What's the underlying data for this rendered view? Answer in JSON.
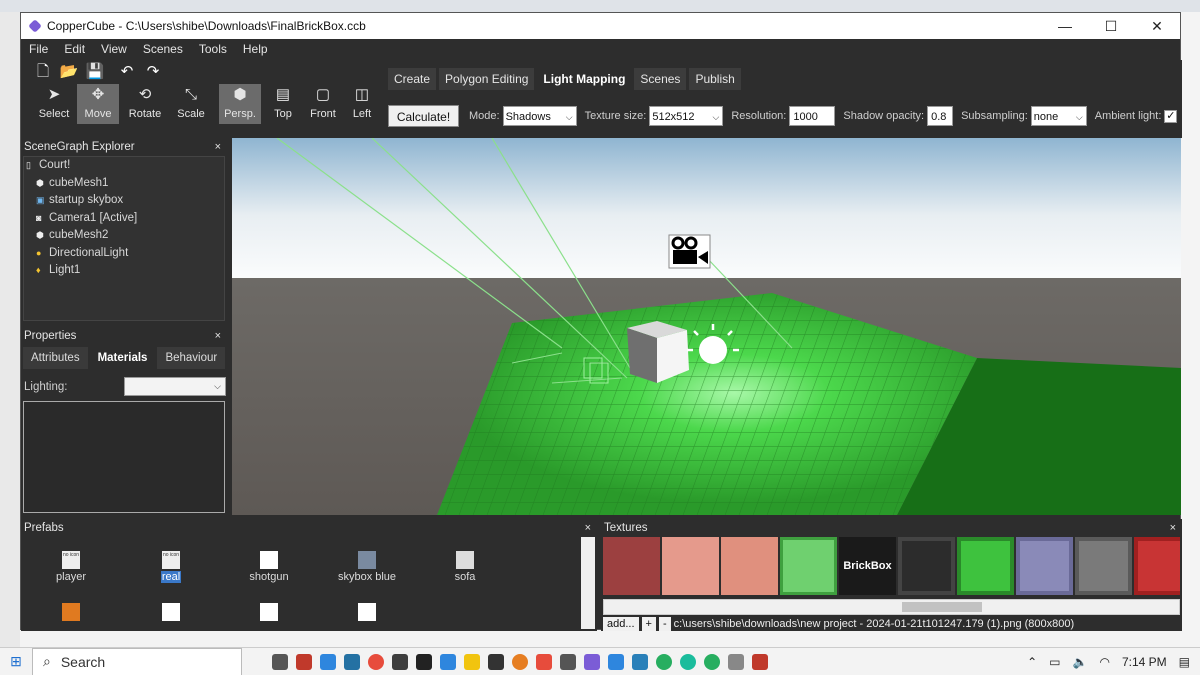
{
  "window": {
    "title": "CopperCube - C:\\Users\\shibe\\Downloads\\FinalBrickBox.ccb",
    "minimize": "—",
    "maximize": "☐",
    "close": "✕"
  },
  "menu": [
    "File",
    "Edit",
    "View",
    "Scenes",
    "Tools",
    "Help"
  ],
  "tools": [
    {
      "label": "Select",
      "icon": "cursor-icon"
    },
    {
      "label": "Move",
      "icon": "move-icon"
    },
    {
      "label": "Rotate",
      "icon": "rotate-icon"
    },
    {
      "label": "Scale",
      "icon": "scale-icon"
    },
    {
      "label": "Persp.",
      "icon": "cube-icon"
    },
    {
      "label": "Top",
      "icon": "top-view-icon"
    },
    {
      "label": "Front",
      "icon": "front-view-icon"
    },
    {
      "label": "Left",
      "icon": "left-view-icon"
    }
  ],
  "mode_tabs": [
    "Create",
    "Polygon Editing",
    "Light Mapping",
    "Scenes",
    "Publish"
  ],
  "light_mapping": {
    "calculate": "Calculate!",
    "mode_label": "Mode:",
    "mode_value": "Shadows",
    "texture_label": "Texture size:",
    "texture_value": "512x512",
    "resolution_label": "Resolution:",
    "resolution_value": "1000",
    "opacity_label": "Shadow opacity:",
    "opacity_value": "0.8",
    "subsampling_label": "Subsampling:",
    "subsampling_value": "none",
    "ambient_label": "Ambient light:",
    "ambient_checked": "✓"
  },
  "scenegraph": {
    "title": "SceneGraph Explorer",
    "close": "×",
    "items": [
      {
        "label": "Court!",
        "indent": 0
      },
      {
        "label": "cubeMesh1",
        "indent": 1
      },
      {
        "label": "startup skybox",
        "indent": 1
      },
      {
        "label": "Camera1 [Active]",
        "indent": 1
      },
      {
        "label": "cubeMesh2",
        "indent": 1
      },
      {
        "label": "DirectionalLight",
        "indent": 1
      },
      {
        "label": "Light1",
        "indent": 1
      }
    ]
  },
  "properties": {
    "title": "Properties",
    "close": "×",
    "tabs": [
      "Attributes",
      "Materials",
      "Behaviour"
    ],
    "lighting_label": "Lighting:"
  },
  "prefabs": {
    "title": "Prefabs",
    "close": "×",
    "items": [
      "player",
      "real",
      "shotgun",
      "skybox blue",
      "sofa"
    ],
    "thumb_text": "no icon"
  },
  "textures": {
    "title": "Textures",
    "close": "×",
    "brickbox_text": "BrickBox",
    "add": "add...",
    "plus": "+",
    "minus": "-",
    "path": "c:\\users\\shibe\\downloads\\new project - 2024-01-21t101247.179 (1).png (800x800)",
    "swatches": [
      "#9c4040",
      "#e59a8c",
      "#e0907e",
      "#6fd06f",
      "#1a1a1a",
      "#2c2c2c",
      "#3ec23e",
      "#8a8ab8",
      "#7a7a7a",
      "#c83434"
    ]
  },
  "taskbar": {
    "search": "Search",
    "time": "7:14 PM"
  }
}
